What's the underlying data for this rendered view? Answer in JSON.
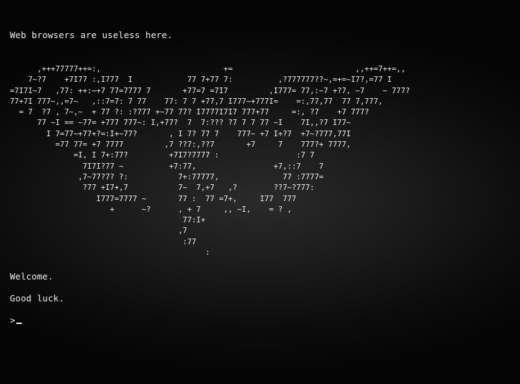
{
  "terminal": {
    "header_message": "Web browsers are useless here.",
    "ascii_art": "      ,+++77777++=:,                           +=                           ,,++=7++=,,\n    7~?7    +7I77 :,I777  I            77 7+77 7:          ,?777777??~,=+=~I7?,=77 I\n=7I7I~7   ,77: ++:~+7 77=7777 7       +77=7 =7I7         ,I777= 77,:~7 +?7, ~7    ~ 777?\n77+7I 777~,,=7~   ,::7=7: 7 77    77: 7 7 +77,7 I777~+777I=    =:,77,77  77 7,777,\n  = 7  ?7 , 7~,~  + 77 ?: :?777 +~77 77? I7777I7I7 777+77     =:, ?7    +7 777?\n      77 ~I == ~77= +777 777~: I,+77?  7  7:??? ?7 7 7 77 ~I    7I,,?7 I77~\n        I 7=77~+77+?=:I+~77?       , I 7? 77 7    777~ +7 I+?7  +7~?777,77I\n          =77 77= +7 7777         ,7 ??7:,??7       +7     7    777?+ 7777,\n              =I, I 7+:77?         +7I7?7777 :                 :7 7\n                7I7I?77 ~          +7:77,                 +7,::7    7\n               ,7~77?7? ?:           7+:77777,              77 :7777=\n                ?77 +I7+,7           7~  7,+7   ,?        ??7~?777:\n                   I777=7777 ~       77 :  77 =7+,     I77  777\n                      +      ~?      , + 7     ,, ~I,    = ? ,\n                                      77:I+\n                                     ,7\n                                      :77\n                                           :",
    "welcome_message": "Welcome.",
    "luck_message": "Good luck.",
    "prompt_symbol": ">"
  }
}
